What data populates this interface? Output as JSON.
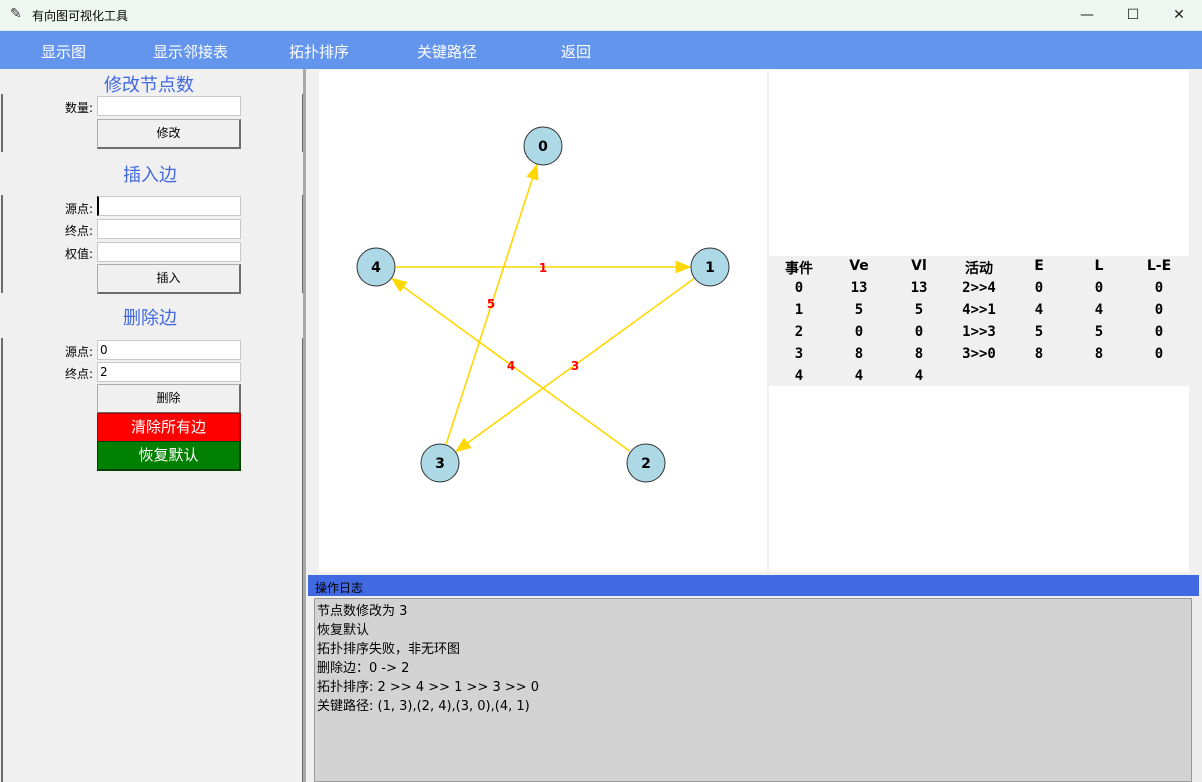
{
  "window": {
    "title": "有向图可视化工具",
    "icon": "feather-icon",
    "controls": {
      "minimize": "—",
      "maximize": "☐",
      "close": "✕"
    }
  },
  "menu": {
    "items": [
      {
        "label": "显示图"
      },
      {
        "label": "显示邻接表"
      },
      {
        "label": "拓扑排序"
      },
      {
        "label": "关键路径"
      },
      {
        "label": "返回"
      }
    ]
  },
  "sidebar": {
    "modify_nodes": {
      "title": "修改节点数",
      "count_label": "数量:",
      "count_value": "",
      "button": "修改"
    },
    "insert_edge": {
      "title": "插入边",
      "source_label": "源点:",
      "target_label": "终点:",
      "weight_label": "权值:",
      "source_value": "",
      "target_value": "",
      "weight_value": "",
      "button": "插入"
    },
    "delete_edge": {
      "title": "删除边",
      "source_label": "源点:",
      "target_label": "终点:",
      "source_value": "0",
      "target_value": "2",
      "button": "删除"
    },
    "clear_button": "清除所有边",
    "restore_button": "恢复默认"
  },
  "graph": {
    "nodes": [
      {
        "id": "0",
        "label": "0"
      },
      {
        "id": "1",
        "label": "1"
      },
      {
        "id": "2",
        "label": "2"
      },
      {
        "id": "3",
        "label": "3"
      },
      {
        "id": "4",
        "label": "4"
      }
    ],
    "edges": [
      {
        "from": "4",
        "to": "1",
        "weight": "1"
      },
      {
        "from": "1",
        "to": "3",
        "weight": "3"
      },
      {
        "from": "2",
        "to": "4",
        "weight": "4"
      },
      {
        "from": "3",
        "to": "0",
        "weight": "5"
      }
    ],
    "colors": {
      "node_fill": "#add8e6",
      "edge": "#ffd700",
      "weight_label": "#ff0000"
    }
  },
  "critical_table": {
    "headers": [
      "事件",
      "Ve",
      "Vl",
      "活动",
      "E",
      "L",
      "L-E"
    ],
    "rows": [
      [
        "0",
        "13",
        "13",
        "2>>4",
        "0",
        "0",
        "0"
      ],
      [
        "1",
        "5",
        "5",
        "4>>1",
        "4",
        "4",
        "0"
      ],
      [
        "2",
        "0",
        "0",
        "1>>3",
        "5",
        "5",
        "0"
      ],
      [
        "3",
        "8",
        "8",
        "3>>0",
        "8",
        "8",
        "0"
      ],
      [
        "4",
        "4",
        "4",
        "",
        "",
        "",
        ""
      ]
    ]
  },
  "log": {
    "title": "操作日志",
    "lines": [
      "节点数修改为 3",
      "恢复默认",
      "拓扑排序失败，非无环图",
      "删除边：0 -> 2",
      "拓扑排序: 2 >> 4 >> 1 >> 3 >> 0",
      "关键路径: (1, 3),(2, 4),(3, 0),(4, 1)"
    ]
  }
}
